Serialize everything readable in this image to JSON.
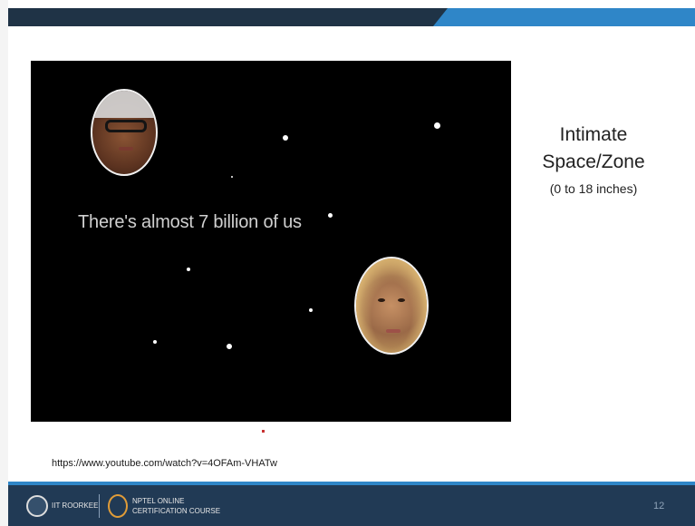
{
  "video": {
    "caption": "There's almost 7 billion of us"
  },
  "side": {
    "title_line1": "Intimate",
    "title_line2": "Space/Zone",
    "subtitle": "(0 to 18 inches)"
  },
  "source_url": "https://www.youtube.com/watch?v=4OFAm-VHATw",
  "footer": {
    "institute": "IIT ROORKEE",
    "course_line1": "NPTEL ONLINE",
    "course_line2": "CERTIFICATION COURSE",
    "page_number": "12"
  },
  "colors": {
    "header_dark": "#1f3346",
    "header_accent": "#2f86c8",
    "footer_bg": "#213a55"
  }
}
